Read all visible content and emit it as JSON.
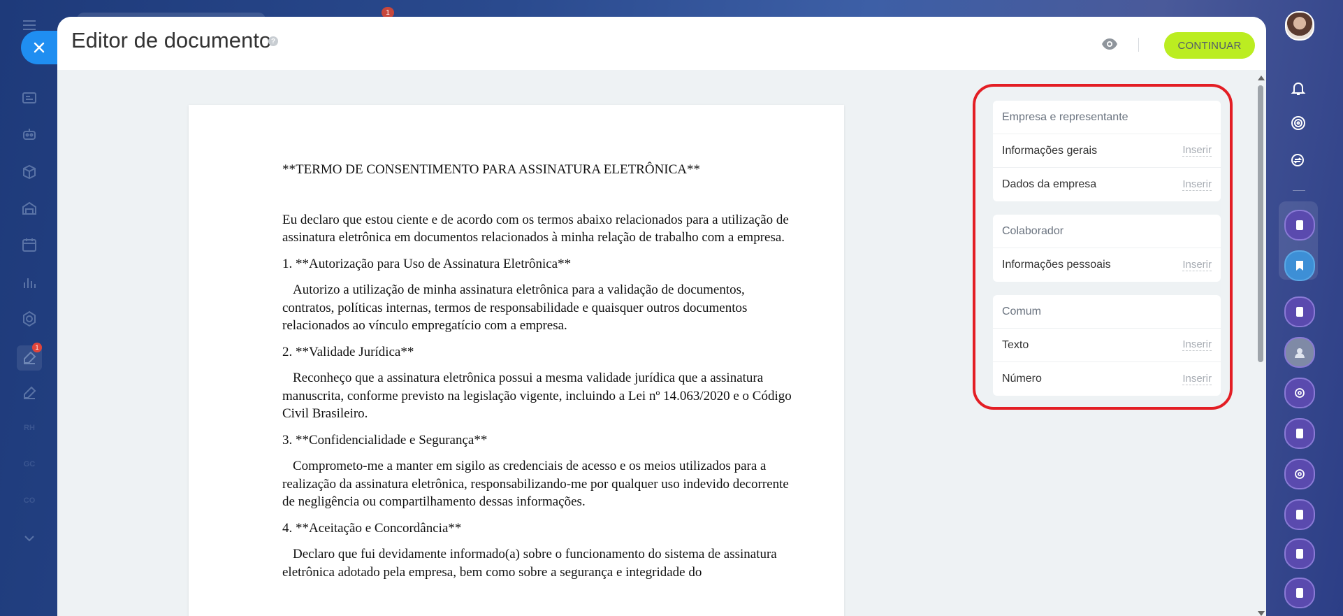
{
  "window": {
    "title": "Editor de documento",
    "help_symbol": "?",
    "continue_label": "CONTINUAR"
  },
  "left_rail": {
    "badges": [
      "1",
      "1"
    ],
    "text_items": [
      "RH",
      "GC",
      "CO"
    ]
  },
  "document": {
    "title": "**TERMO DE CONSENTIMENTO PARA ASSINATURA ELETRÔNICA**",
    "intro": "Eu declaro que estou ciente e de acordo com os termos abaixo relacionados para a utilização de assinatura eletrônica em documentos relacionados à minha relação de trabalho com a empresa.",
    "sections": [
      {
        "heading": "1. **Autorização para Uso de Assinatura Eletrônica**",
        "body": "Autorizo a utilização de minha assinatura eletrônica para a validação de documentos, contratos, políticas internas, termos de responsabilidade e quaisquer outros documentos relacionados ao vínculo empregatício com a empresa."
      },
      {
        "heading": "2. **Validade Jurídica**",
        "body": "Reconheço que a assinatura eletrônica possui a mesma validade jurídica que a assinatura manuscrita, conforme previsto na legislação vigente, incluindo a Lei nº 14.063/2020 e o Código Civil Brasileiro."
      },
      {
        "heading": "3. **Confidencialidade e Segurança**",
        "body": "Comprometo-me a manter em sigilo as credenciais de acesso e os meios utilizados para a realização da assinatura eletrônica, responsabilizando-me por qualquer uso indevido decorrente de negligência ou compartilhamento dessas informações."
      },
      {
        "heading": "4. **Aceitação e Concordância**",
        "body": "Declaro que fui devidamente informado(a) sobre o funcionamento do sistema de assinatura eletrônica adotado pela empresa, bem como sobre a segurança e integridade do"
      }
    ]
  },
  "fields_panel": {
    "insert_label": "Inserir",
    "groups": [
      {
        "header": "Empresa e representante",
        "items": [
          "Informações gerais",
          "Dados da empresa"
        ]
      },
      {
        "header": "Colaborador",
        "items": [
          "Informações pessoais"
        ]
      },
      {
        "header": "Comum",
        "items": [
          "Texto",
          "Número"
        ]
      }
    ]
  },
  "colors": {
    "accent_button": "#bbed21",
    "close_button": "#1f8ef1",
    "highlight_outline": "#e31e24"
  }
}
